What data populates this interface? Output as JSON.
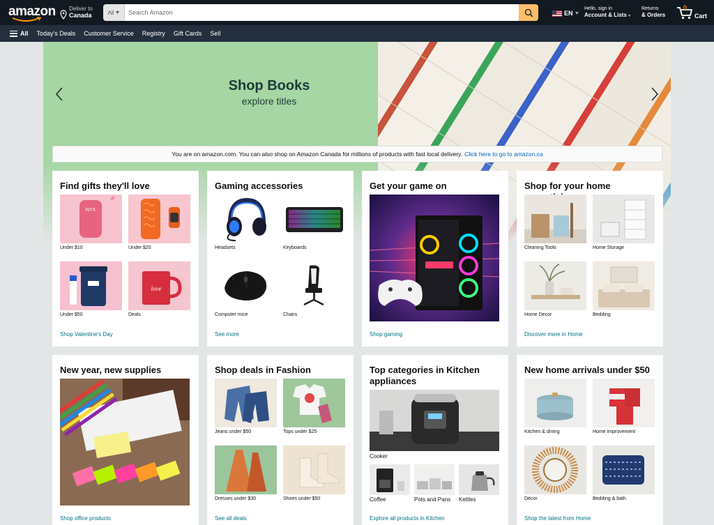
{
  "header": {
    "logo_text": "amazon",
    "deliver_line1": "Deliver to",
    "deliver_line2": "Canada",
    "search_category": "All",
    "search_placeholder": "Search Amazon",
    "language": "EN",
    "account_line1": "Hello, sign in",
    "account_line2": "Account & Lists",
    "returns_line1": "Returns",
    "returns_line2": "& Orders",
    "cart_count": "0",
    "cart_label": "Cart"
  },
  "subnav": {
    "all_label": "All",
    "items": [
      "Today's Deals",
      "Customer Service",
      "Registry",
      "Gift Cards",
      "Sell"
    ]
  },
  "hero": {
    "title": "Shop Books",
    "subtitle": "explore titles"
  },
  "notice": {
    "text": "You are on amazon.com. You can also shop on Amazon Canada for millions of products with fast local delivery.",
    "link": "Click here to go to amazon.ca"
  },
  "cards": [
    {
      "title": "Find gifts they'll love",
      "items": [
        "Under $10",
        "Under $20",
        "Under $50",
        "Deals"
      ],
      "link": "Shop Valentine's Day"
    },
    {
      "title": "Gaming accessories",
      "items": [
        "Headsets",
        "Keyboards",
        "Computer mice",
        "Chairs"
      ],
      "link": "See more"
    },
    {
      "title": "Get your game on",
      "link": "Shop gaming"
    },
    {
      "title": "Shop for your home essentials",
      "items": [
        "Cleaning Tools",
        "Home Storage",
        "Home Decor",
        "Bedding"
      ],
      "link": "Discover more in Home"
    },
    {
      "title": "New year, new supplies",
      "link": "Shop office products"
    },
    {
      "title": "Shop deals in Fashion",
      "items": [
        "Jeans under $50",
        "Tops under $25",
        "Dresses under $30",
        "Shoes under $50"
      ],
      "link": "See all deals"
    },
    {
      "title": "Top categories in Kitchen appliances",
      "main_item": "Cooker",
      "items": [
        "Coffee",
        "Pots and Pans",
        "Kettles"
      ],
      "link": "Explore all products in Kitchen"
    },
    {
      "title": "New home arrivals under $50",
      "items": [
        "Kitchen & dining",
        "Home improvement",
        "Décor",
        "Bedding & bath"
      ],
      "link": "Shop the latest from Home"
    }
  ],
  "colors": {
    "nav_dark": "#131921",
    "nav_sub": "#232f3e",
    "search_button": "#febd69",
    "cart_count": "#f08804",
    "link": "#007185",
    "hero_green": "#a5d6a3"
  }
}
